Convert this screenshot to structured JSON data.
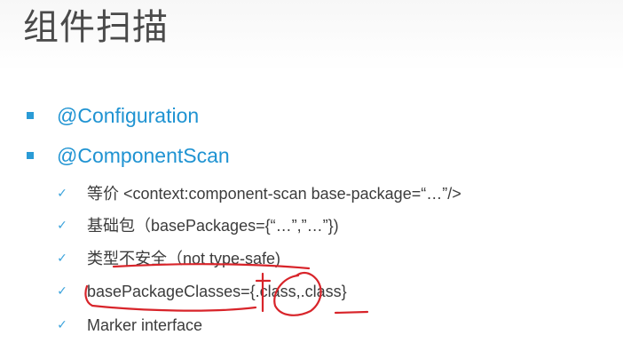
{
  "slide": {
    "title": "组件扫描",
    "bullets": [
      {
        "text": "@Configuration"
      },
      {
        "text": "@ComponentScan"
      }
    ],
    "subitems": [
      {
        "text": "等价   <context:component-scan base-package=“…”/>"
      },
      {
        "text": "基础包（basePackages={“…”,”…”})"
      },
      {
        "text": "类型不安全（not type-safe)"
      },
      {
        "text": "basePackageClasses={.class,.class}"
      },
      {
        "text": "Marker interface"
      }
    ]
  },
  "colors": {
    "accent": "#2a9bd6",
    "heading_text": "#1f93d2",
    "body_text": "#3c3c3c",
    "annotation_ink": "#d8242a"
  }
}
